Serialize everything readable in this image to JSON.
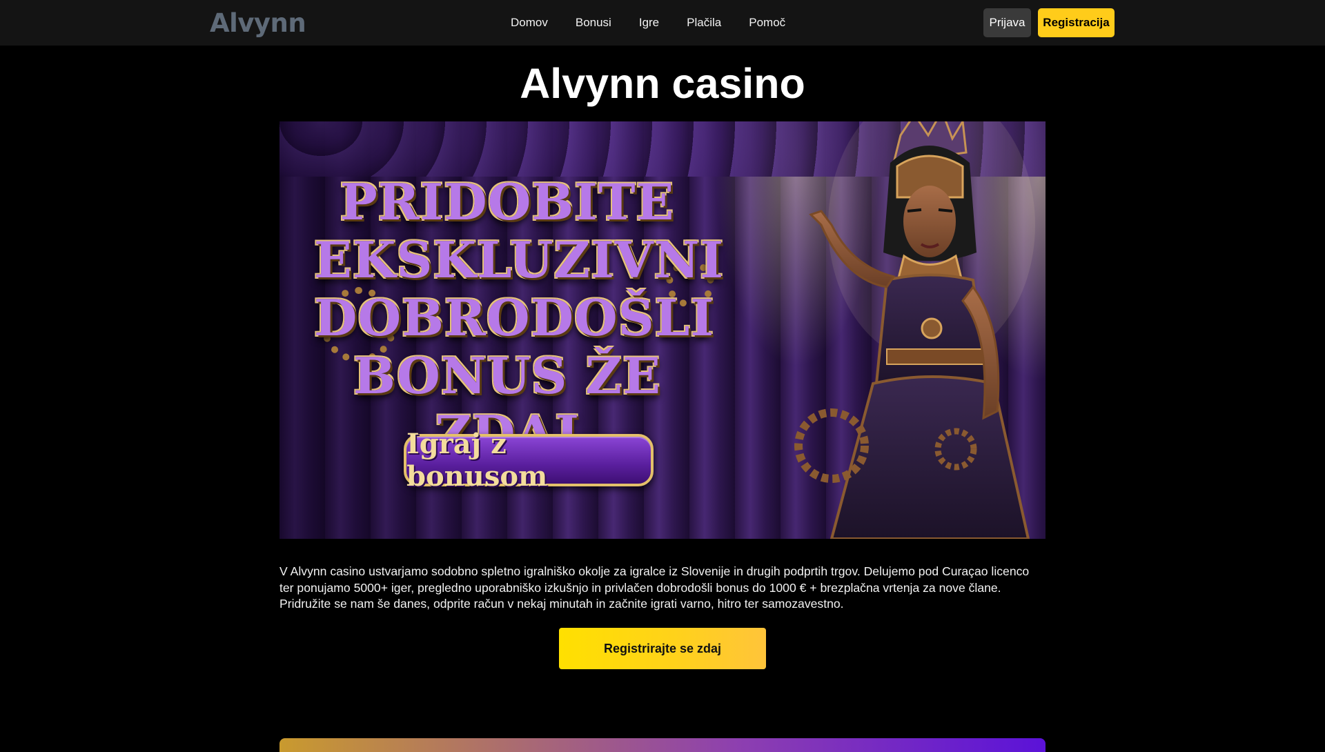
{
  "header": {
    "logo_text": "Alvynn",
    "nav": [
      "Domov",
      "Bonusi",
      "Igre",
      "Plačila",
      "Pomoč"
    ],
    "login_label": "Prijava",
    "register_label": "Registracija"
  },
  "main": {
    "title": "Alvynn casino",
    "banner": {
      "headline_lines": [
        "PRIDOBITE",
        "EKSKLUZIVNI",
        "DOBRODOŠLI",
        "BONUS ŽE ZDAJ"
      ],
      "cta_label": "Igraj z bonusom"
    },
    "intro": "V Alvynn casino ustvarjamo sodobno spletno igralniško okolje za igralce iz Slovenije in drugih podprtih trgov. Delujemo pod Curaçao licenco ter ponujamo 5000+ iger, pregledno uporabniško izkušnjo in privlačen dobrodošli bonus do 1000 € + brezplačna vrtenja za nove člane. Pridružite se nam še danes, odprite račun v nekaj minutah in začnite igrati varno, hitro ter samozavestno.",
    "cta_label": "Registrirajte se zdaj"
  },
  "colors": {
    "accent_yellow": "#ffcc1a",
    "header_bg": "#141414",
    "banner_purple": "#4b2a78"
  }
}
